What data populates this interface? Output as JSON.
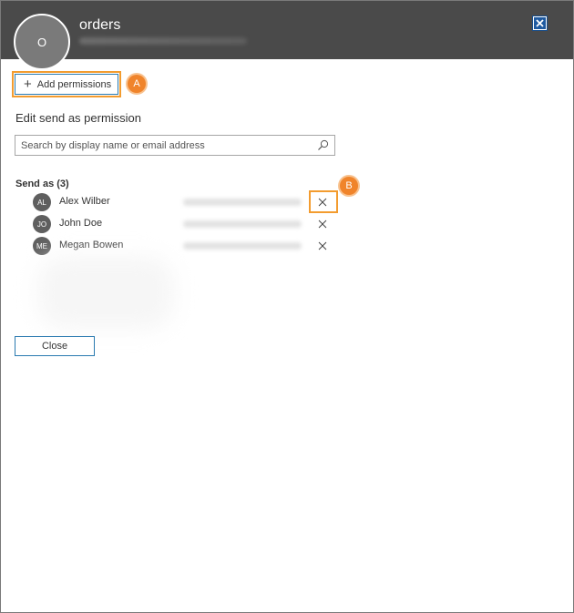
{
  "header": {
    "title": "orders",
    "avatar_initial": "O",
    "close_icon": "close-icon"
  },
  "toolbar": {
    "add_permissions_label": "Add permissions",
    "add_icon": "plus-icon"
  },
  "annotations": {
    "a": "A",
    "b": "B",
    "color": "#f0842b"
  },
  "panel": {
    "title": "Edit send as permission",
    "search_placeholder": "Search by display name or email address",
    "list_title": "Send as (3)",
    "close_label": "Close"
  },
  "users": [
    {
      "initials": "AL",
      "name": "Alex Wilber"
    },
    {
      "initials": "JO",
      "name": "John Doe"
    },
    {
      "initials": "ME",
      "name": "Megan Bowen"
    }
  ],
  "colors": {
    "header_bg": "#4a4a4a",
    "accent": "#2a7ab0",
    "highlight": "#f39c2f"
  }
}
